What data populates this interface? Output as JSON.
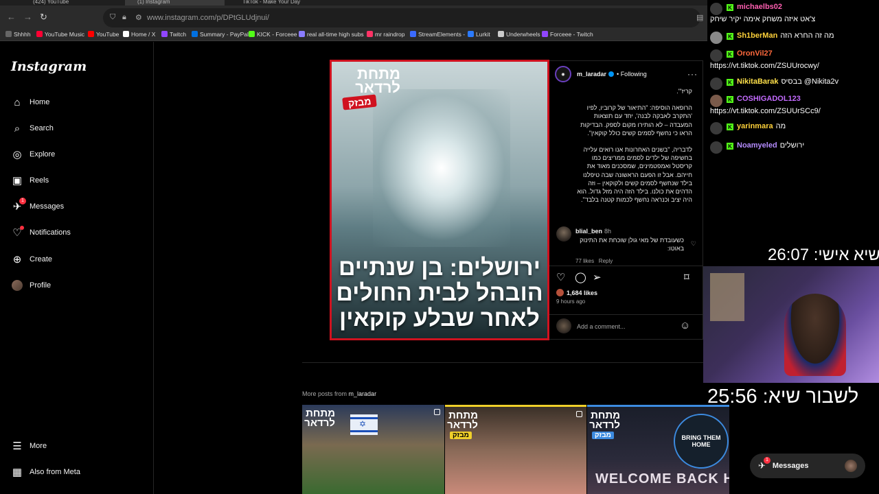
{
  "browser": {
    "tabs": [
      "(424) YouTube",
      "(1) Instagram",
      "TikTok - Make Your Day"
    ],
    "url": "www.instagram.com/p/DPtGLUdjnui/",
    "bookmarks": [
      "Shhhh",
      "YouTube Music",
      "YouTube",
      "Home / X",
      "Twitch",
      "Summary - PayPal",
      "KICK - Forceee",
      "real all-time high subs",
      "mr raindrop",
      "StreamElements -",
      "Lurkit",
      "Underwheels",
      "Forceee - Twitch"
    ],
    "bookmark_colors": [
      "#666666",
      "#ff0033",
      "#ff0000",
      "#ffffff",
      "#9146ff",
      "#0070e0",
      "#53fc18",
      "#8a7cff",
      "#ff3366",
      "#3b6bff",
      "#2b7bff",
      "#cccccc",
      "#9146ff"
    ]
  },
  "sidebar": {
    "logo": "Instagram",
    "items": [
      {
        "label": "Home",
        "icon": "home-icon"
      },
      {
        "label": "Search",
        "icon": "search-icon"
      },
      {
        "label": "Explore",
        "icon": "explore-icon"
      },
      {
        "label": "Reels",
        "icon": "reels-icon"
      },
      {
        "label": "Messages",
        "icon": "messages-icon",
        "badge": "1"
      },
      {
        "label": "Notifications",
        "icon": "heart-icon"
      },
      {
        "label": "Create",
        "icon": "plus-icon"
      },
      {
        "label": "Profile",
        "icon": "avatar"
      }
    ],
    "bottom": [
      {
        "label": "More",
        "icon": "menu-icon"
      },
      {
        "label": "Also from Meta",
        "icon": "meta-icon"
      }
    ]
  },
  "post": {
    "media": {
      "logo": "מתחת לרדאר",
      "tag": "מבזק",
      "headline": "ירושלים: בן שנתיים הובהל לבית החולים לאחר שבלע קוקאין"
    },
    "account": "m_laradar",
    "follow_state": "Following",
    "caption_paragraphs": [
      "קריז'\".",
      "הרופאה הוסיפה: \"התיאור של קרוביו, לפיו 'התקרב לאבקה לבנה', יחד עם תוצאות המעבדה – לא הותירו מקום לספק. הבדיקות הראו כי נחשף לסמים קשים כולל קוקאין\".",
      "לדבריה, \"בשנים האחרונות אנו רואים עלייה בחשיפה של ילדים לסמים ממריצים כמו קריסטל ואמפטמינים, שמסכנים מאוד את חייהם. אבל זו הפעם הראשונה שבה טיפלנו בילד שנחשף לסמים קשים ולקוקאין – וזה הדהים את כולנו. בילד הזה היה מזל גדול. הוא היה יציב וכנראה נחשף לכמות קטנה בלבד\"."
    ],
    "comment": {
      "user": "blial_ben",
      "time": "8h",
      "text": "כשעובדת של מאי גולן שוכחת את התינוק באוטו:",
      "likes": "77 likes",
      "reply": "Reply"
    },
    "likes": "1,684 likes",
    "ago": "9 hours ago",
    "add_comment_placeholder": "Add a comment..."
  },
  "more_posts": {
    "prefix": "More posts from",
    "account": "m_laradar",
    "thumbs": [
      {
        "logo": "מתחת לרדאר",
        "tag": "",
        "caption": ""
      },
      {
        "logo": "מתחת לרדאר",
        "tag": "מבזק",
        "caption": ""
      },
      {
        "logo": "מתחת לרדאר",
        "tag": "מבזק",
        "sign": "BRING THEM HOME",
        "caption": "WELCOME BACK HOME"
      }
    ]
  },
  "messages_pill": {
    "label": "Messages",
    "badge": "1"
  },
  "stream": {
    "chat": [
      {
        "user": "michaelbs02",
        "text": "צ'אט איזה משחק אימה יקיר שיחק",
        "color": "#ff5fb1"
      },
      {
        "user": "Sh1berMan",
        "text": "מה זה החרא הזה",
        "color": "#ffd23a"
      },
      {
        "user": "OronVil27",
        "text": "https://vt.tiktok.com/ZSUUrocwy/",
        "color": "#ff6a3d"
      },
      {
        "user": "NikitaBarak",
        "text": "בבסיס @Nikita2v",
        "color": "#ffe04a"
      },
      {
        "user": "COSHIGADOL123",
        "text": "https://vt.tiktok.com/ZSUUrSCc9/",
        "color": "#c46bff"
      },
      {
        "user": "yarinmara",
        "text": "מה",
        "color": "#ffd23a"
      },
      {
        "user": "Noamyeled",
        "text": "ירושלים",
        "color": "#b58cff"
      }
    ],
    "timer_personal": "שיא אישי: 26:07",
    "timer_break": "לשבור שיא: 25:56"
  }
}
